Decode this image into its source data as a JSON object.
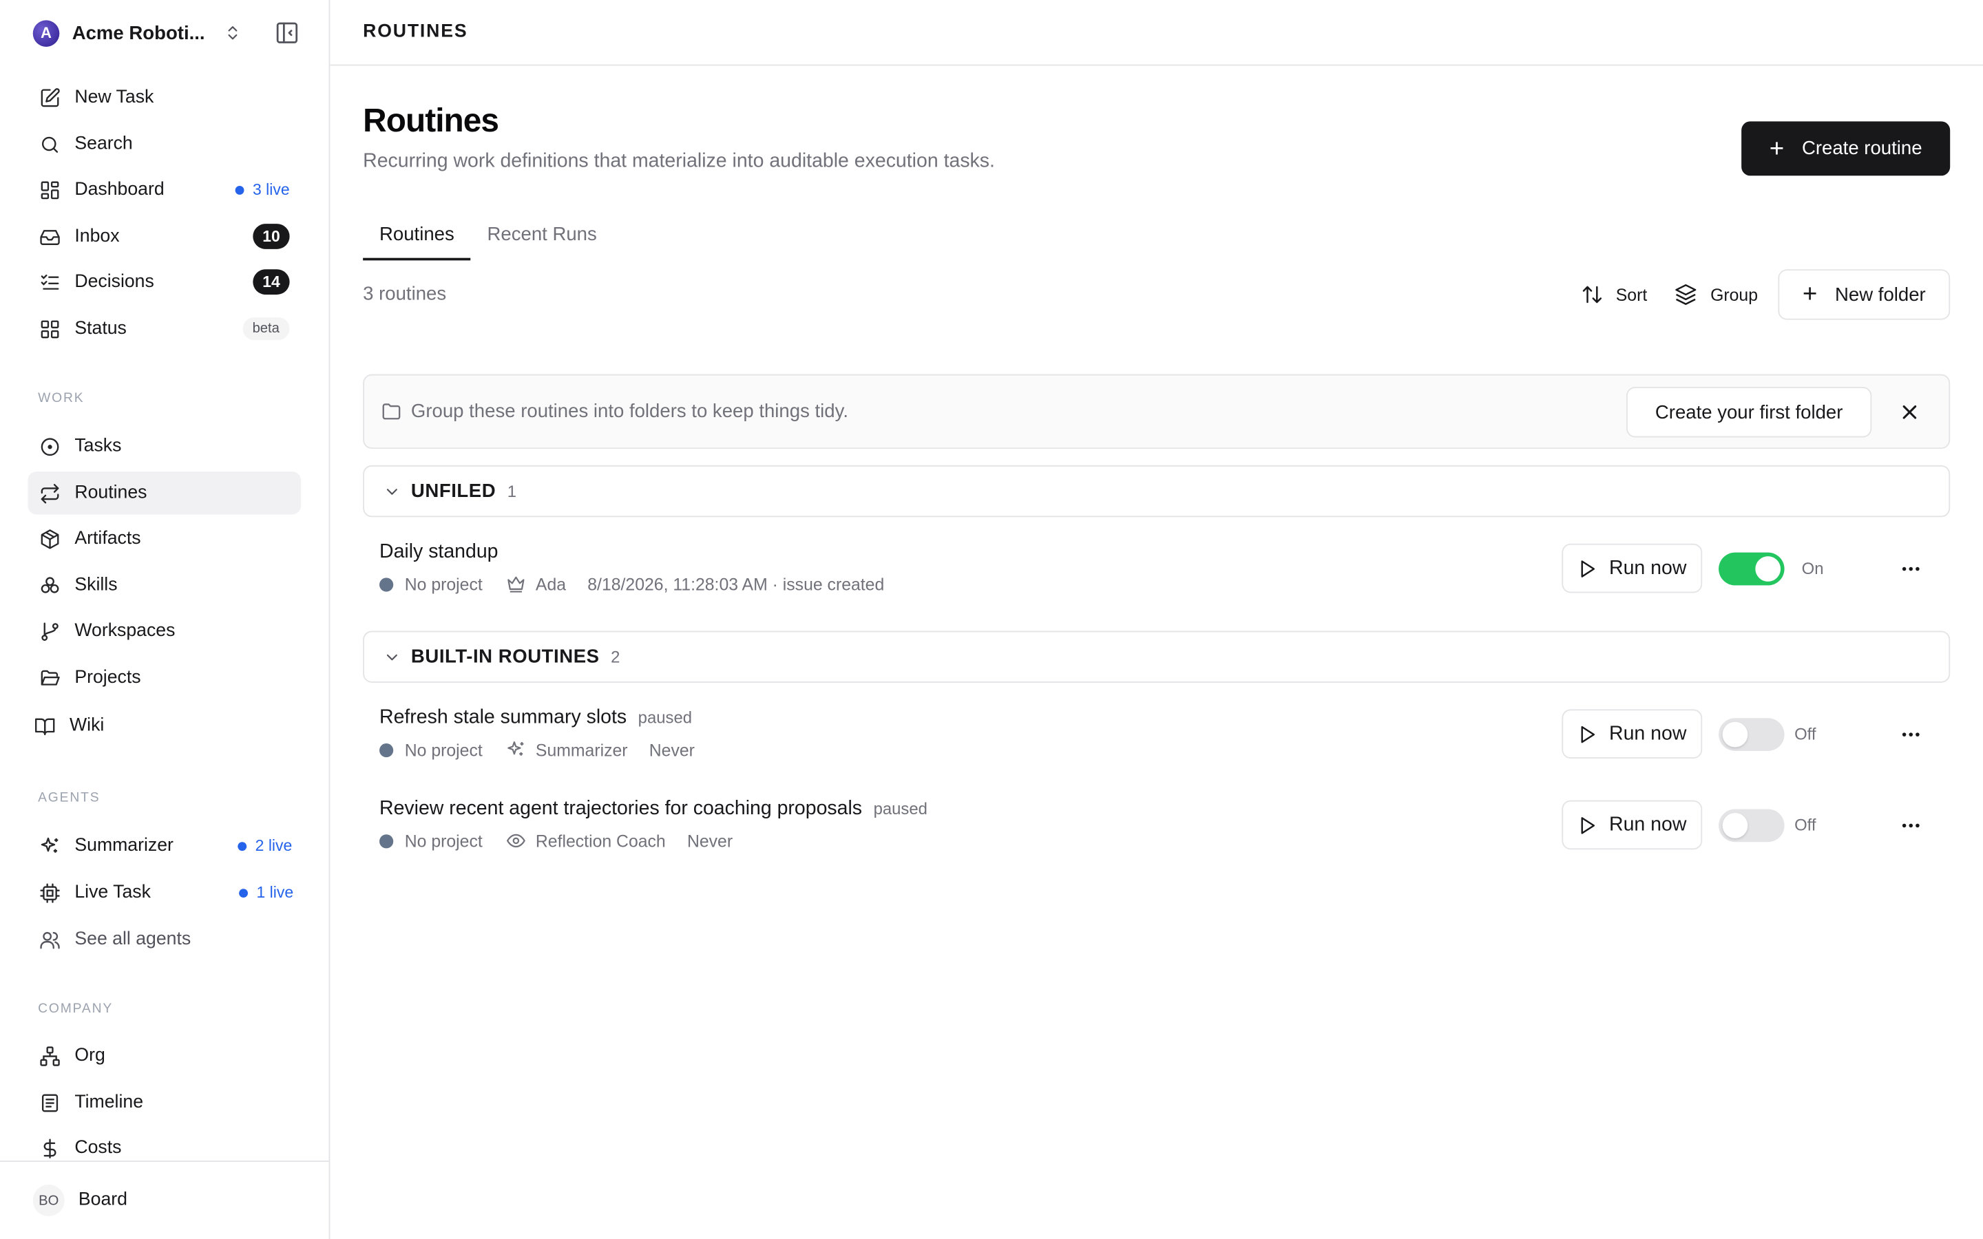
{
  "sidebar": {
    "company": {
      "initial": "A",
      "name": "Acme Roboti..."
    },
    "primary": [
      {
        "label": "New Task"
      },
      {
        "label": "Search"
      },
      {
        "label": "Dashboard",
        "live": "3 live"
      },
      {
        "label": "Inbox",
        "count": "10"
      },
      {
        "label": "Decisions",
        "count": "14"
      },
      {
        "label": "Status",
        "badge": "beta"
      }
    ],
    "work_title": "WORK",
    "work": [
      {
        "label": "Tasks"
      },
      {
        "label": "Routines"
      },
      {
        "label": "Artifacts"
      },
      {
        "label": "Skills"
      },
      {
        "label": "Workspaces"
      },
      {
        "label": "Projects"
      },
      {
        "label": "Wiki"
      }
    ],
    "agents_title": "AGENTS",
    "agents": [
      {
        "label": "Summarizer",
        "live": "2 live"
      },
      {
        "label": "Live Task",
        "live": "1 live"
      },
      {
        "label": "See all agents"
      }
    ],
    "company_title": "COMPANY",
    "company_items": [
      {
        "label": "Org"
      },
      {
        "label": "Timeline"
      },
      {
        "label": "Costs"
      }
    ],
    "footer": {
      "initials": "BO",
      "label": "Board"
    }
  },
  "header": {
    "breadcrumb": "ROUTINES"
  },
  "page": {
    "title": "Routines",
    "subtitle": "Recurring work definitions that materialize into auditable execution tasks.",
    "create_label": "Create routine",
    "tabs": [
      {
        "label": "Routines"
      },
      {
        "label": "Recent Runs"
      }
    ],
    "count": "3 routines",
    "sort_label": "Sort",
    "group_label": "Group",
    "new_folder_label": "New folder"
  },
  "hint": {
    "text": "Group these routines into folders to keep things tidy.",
    "button": "Create your first folder"
  },
  "groups": [
    {
      "title": "UNFILED",
      "count": "1",
      "routines": [
        {
          "name": "Daily standup",
          "status_tag": "",
          "project": "No project",
          "agent": "Ada",
          "agent_icon": "crown-icon",
          "last_run": "8/18/2026, 11:28:03 AM · issue created",
          "run_label": "Run now",
          "enabled": true,
          "toggle_label": "On"
        }
      ]
    },
    {
      "title": "BUILT-IN ROUTINES",
      "count": "2",
      "routines": [
        {
          "name": "Refresh stale summary slots",
          "status_tag": "paused",
          "project": "No project",
          "agent": "Summarizer",
          "agent_icon": "sparkles-icon",
          "last_run": "Never",
          "run_label": "Run now",
          "enabled": false,
          "toggle_label": "Off"
        },
        {
          "name": "Review recent agent trajectories for coaching proposals",
          "status_tag": "paused",
          "project": "No project",
          "agent": "Reflection Coach",
          "agent_icon": "eye-icon",
          "last_run": "Never",
          "run_label": "Run now",
          "enabled": false,
          "toggle_label": "Off"
        }
      ]
    }
  ],
  "colors": {
    "accent": "#18181b",
    "live": "#2563eb",
    "toggle_on": "#22c55e",
    "project_dot": "#64748b"
  }
}
